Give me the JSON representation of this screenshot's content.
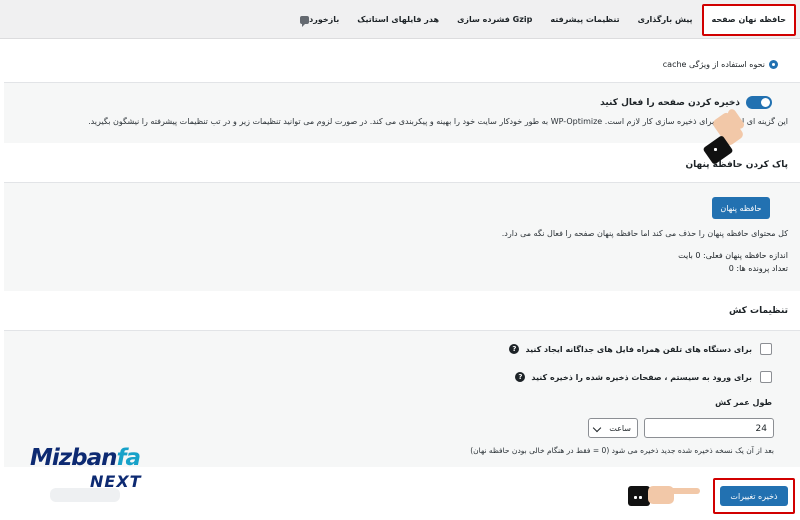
{
  "tabs": [
    {
      "label": "حافظه نهان صفحه",
      "active": true
    },
    {
      "label": "پیش بارگذاری",
      "active": false
    },
    {
      "label": "تنظیمات پیشرفته",
      "active": false
    },
    {
      "label": "فشرده سازی Gzip",
      "active": false
    },
    {
      "label": "هدر فایلهای استاتیک",
      "active": false
    },
    {
      "label": "بازخورد",
      "active": false,
      "icon": "feedback-icon"
    }
  ],
  "howto": {
    "label": "نحوه استفاده از ویژگی cache",
    "icon": "help-circle-icon"
  },
  "enable_cache": {
    "label": "ذخیره کردن صفحه را فعال کنید",
    "enabled": true,
    "description": "این گزینه ای است که برای ذخیره سازی کار لازم است. WP-Optimize به طور خودکار سایت خود را بهینه و پیکربندی می کند. در صورت لزوم می توانید تنظیمات زیر و در تب تنظیمات پیشرفته را نیشگون بگیرید."
  },
  "purge": {
    "title": "پاک کردن حافظه پنهان",
    "button": "حافظه پنهان",
    "description": "کل محتوای حافظه پنهان را حذف می کند اما حافظه پنهان صفحه را فعال نگه می دارد.",
    "size_line": "اندازه حافظه پنهان فعلی: 0 بایت",
    "files_line": "تعداد پرونده ها: 0"
  },
  "settings": {
    "title": "تنظیمات کش",
    "mobile_label": "برای دستگاه های تلفن همراه فایل های جداگانه ایجاد کنید",
    "mobile_checked": false,
    "loggedin_label": "برای ورود به سیستم ، صفحات ذخیره شده را ذخیره کنید",
    "loggedin_checked": false,
    "lifespan_label": "طول عمر کش",
    "lifespan_value": "24",
    "lifespan_unit": "ساعت",
    "lifespan_desc": "بعد از آن یک نسخه ذخیره شده جدید ذخیره می شود (0 = فقط در هنگام خالی بودن حافظه نهان)"
  },
  "save_button": "ذخیره تغییرات",
  "brand": {
    "line1_a": "Mizban",
    "line1_b": "fa",
    "line2": "NEXT"
  },
  "colors": {
    "primary": "#2271b1",
    "highlight": "#d10000",
    "brand_dark": "#0d2a72",
    "brand_light": "#17a2c9"
  }
}
